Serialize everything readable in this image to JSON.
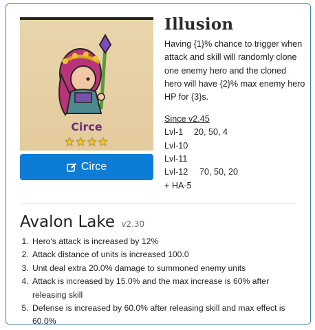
{
  "hero": {
    "name": "Circe",
    "stars": "★★★★",
    "button_label": "Circe",
    "icon": "edit-icon"
  },
  "skill": {
    "title": "Illusion",
    "description": "Having {1}% chance to trigger when attack and skill will randomly clone one enemy hero and the cloned hero will have {2}% max enemy hero HP for {3}s.",
    "since": "Since v2.45",
    "levels": [
      {
        "level": "Lvl-1",
        "values": "20, 50, 4"
      },
      {
        "level": "Lvl-10",
        "values": ""
      },
      {
        "level": "Lvl-11",
        "values": ""
      },
      {
        "level": "Lvl-12",
        "values": "70, 50, 20"
      }
    ],
    "extra": "+ HA-5"
  },
  "lake": {
    "title": "Avalon Lake",
    "version": "v2.30",
    "effects": [
      "Hero's attack is increased by 12%",
      "Attack distance of units is increased 100.0",
      "Unit deal extra 20.0% damage to summoned enemy units",
      "Attack is increased by 15.0% and the max increase is 60% after releasing skill",
      "Defense is increased by 60.0% after releasing skill and max effect is 60.0%"
    ]
  },
  "colors": {
    "accent": "#0d7cd6",
    "border": "#3d7fb0",
    "hero_name": "#6b2d86",
    "star": "#f5c518"
  }
}
